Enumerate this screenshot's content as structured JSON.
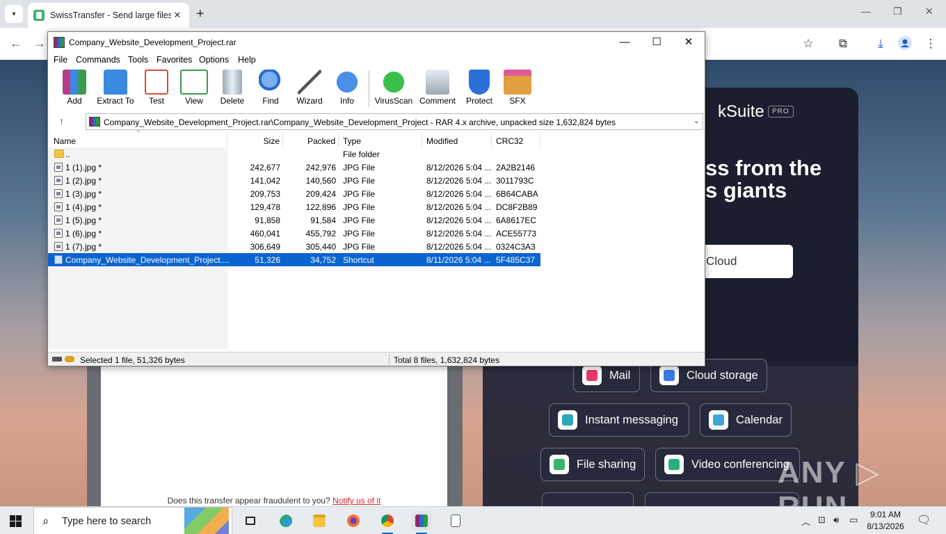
{
  "browser": {
    "tab_title": "SwissTransfer - Send large files",
    "tab_close": "✕",
    "new_tab": "+",
    "minimize": "—",
    "restore": "❐",
    "close": "✕",
    "back": "←",
    "forward": "→",
    "star": "☆",
    "extensions": "⧉",
    "download": "⤓",
    "menu": "⋮"
  },
  "webpage": {
    "fraud_text": "Does this transfer appear fraudulent to you? ",
    "fraud_link": "Notify us of it",
    "ksuite_logo": "kSuite",
    "ksuite_pro": "PRO",
    "headline": "ss from the\ns giants",
    "cloud_button": "Cloud",
    "pills": [
      {
        "label": "Mail",
        "color": "#e83a6a"
      },
      {
        "label": "Cloud storage",
        "color": "#3a7ae8"
      },
      {
        "label": "Instant messaging",
        "color": "#2aa8b8"
      },
      {
        "label": "Calendar",
        "color": "#3aa8d8"
      },
      {
        "label": "File sharing",
        "color": "#3ab36a"
      },
      {
        "label": "Video conferencing",
        "color": "#2ab07a"
      }
    ],
    "watermark": "ANY ▷ RUN"
  },
  "winrar": {
    "title": "Company_Website_Development_Project.rar",
    "minimize": "—",
    "maximize": "☐",
    "close": "✕",
    "menu": [
      "File",
      "Commands",
      "Tools",
      "Favorites",
      "Options",
      "Help"
    ],
    "tools": [
      {
        "label": "Add",
        "color": "#b83a8a"
      },
      {
        "label": "Extract To",
        "color": "#3a8ae0"
      },
      {
        "label": "Test",
        "color": "#d84a3a"
      },
      {
        "label": "View",
        "color": "#3a9a4a"
      },
      {
        "label": "Delete",
        "color": "#8a9aaa"
      },
      {
        "label": "Find",
        "color": "#2a6ad0"
      },
      {
        "label": "Wizard",
        "color": "#9a8ad0"
      },
      {
        "label": "Info",
        "color": "#2a7ae0"
      },
      {
        "label": "VirusScan",
        "color": "#2aa04a"
      },
      {
        "label": "Comment",
        "color": "#7a8a9a"
      },
      {
        "label": "Protect",
        "color": "#2a70d8"
      },
      {
        "label": "SFX",
        "color": "#e0a040"
      }
    ],
    "up_arrow": "↑",
    "path": "Company_Website_Development_Project.rar\\Company_Website_Development_Project - RAR 4.x archive, unpacked size 1,632,824 bytes",
    "columns": {
      "name": "Name",
      "size": "Size",
      "packed": "Packed",
      "type": "Type",
      "modified": "Modified",
      "crc": "CRC32"
    },
    "rows": [
      {
        "name": "..",
        "size": "",
        "packed": "",
        "type": "File folder",
        "modified": "",
        "crc": "",
        "kind": "folder"
      },
      {
        "name": "1 (1).jpg *",
        "size": "242,677",
        "packed": "242,976",
        "type": "JPG File",
        "modified": "8/12/2026 5:04 ...",
        "crc": "2A2B2146",
        "kind": "jpg"
      },
      {
        "name": "1 (2).jpg *",
        "size": "141,042",
        "packed": "140,560",
        "type": "JPG File",
        "modified": "8/12/2026 5:04 ...",
        "crc": "3011793C",
        "kind": "jpg"
      },
      {
        "name": "1 (3).jpg *",
        "size": "209,753",
        "packed": "209,424",
        "type": "JPG File",
        "modified": "8/12/2026 5:04 ...",
        "crc": "6B64CABA",
        "kind": "jpg"
      },
      {
        "name": "1 (4).jpg *",
        "size": "129,478",
        "packed": "122,896",
        "type": "JPG File",
        "modified": "8/12/2026 5:04 ...",
        "crc": "DC8F2B89",
        "kind": "jpg"
      },
      {
        "name": "1 (5).jpg *",
        "size": "91,858",
        "packed": "91,584",
        "type": "JPG File",
        "modified": "8/12/2026 5:04 ...",
        "crc": "6A8617EC",
        "kind": "jpg"
      },
      {
        "name": "1 (6).jpg *",
        "size": "460,041",
        "packed": "455,792",
        "type": "JPG File",
        "modified": "8/12/2026 5:04 ...",
        "crc": "ACE55773",
        "kind": "jpg"
      },
      {
        "name": "1 (7).jpg *",
        "size": "306,649",
        "packed": "305,440",
        "type": "JPG File",
        "modified": "8/12/2026 5:04 ...",
        "crc": "0324C3A3",
        "kind": "jpg"
      },
      {
        "name": "Company_Website_Development_Project....",
        "size": "51,326",
        "packed": "34,752",
        "type": "Shortcut",
        "modified": "8/11/2026 5:04 ...",
        "crc": "5F485C37",
        "kind": "lnk",
        "selected": true
      }
    ],
    "status_left": "Selected 1 file, 51,326 bytes",
    "status_right": "Total 8 files, 1,632,824 bytes"
  },
  "taskbar": {
    "search_placeholder": "Type here to search",
    "search_icon": "⌕",
    "time": "9:01 AM",
    "date": "8/13/2026",
    "tray_chevron": "︿",
    "tray_notify": "🗨"
  }
}
